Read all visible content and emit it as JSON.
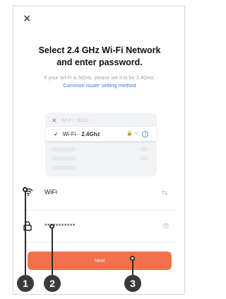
{
  "close_label": "×",
  "title_lines": [
    "Select 2.4 GHz Wi-Fi Network",
    "and enter password."
  ],
  "subtitle": "If your Wi-Fi is 5GHz, please set it to be 2.4GHz.",
  "help_link": "Common router setting method",
  "illustration": {
    "row_5ghz": "Wi-Fi - 5Ghz",
    "row_24_prefix": "Wi-Fi -",
    "row_24_band": "2.4Ghz",
    "row_24_icons": "🔒 ᯤ",
    "info_symbol": "i"
  },
  "wifi_field": {
    "value": "WiFi",
    "icon": "wifi-icon",
    "action_icon": "swap-icon"
  },
  "password_field": {
    "value": "***********",
    "icon": "lock-icon",
    "action_icon": "eye-icon"
  },
  "next_button": "Next",
  "markers": [
    "1",
    "2",
    "3"
  ],
  "colors": {
    "accent": "#f0714a",
    "link": "#3b7ad6",
    "check": "#1f8f6a",
    "error": "#e05a4a"
  }
}
